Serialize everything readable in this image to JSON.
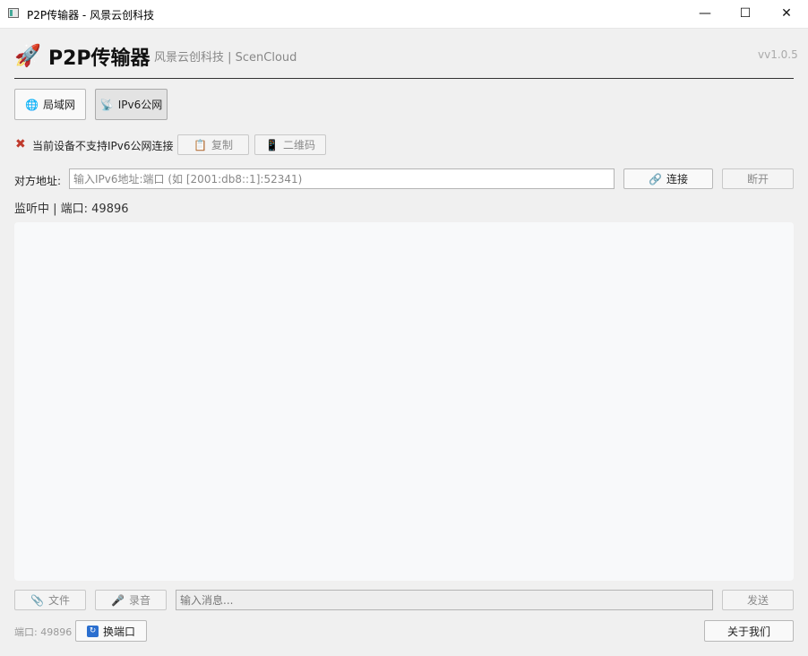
{
  "window": {
    "title": "P2P传输器 - 风景云创科技",
    "minimize_glyph": "—",
    "maximize_glyph": "☐",
    "close_glyph": "✕"
  },
  "header": {
    "logo_icon": "rocket-icon",
    "logo_glyph": "🚀",
    "title": "P2P传输器",
    "subtitle": "风景云创科技 | ScenCloud",
    "version": "vv1.0.5"
  },
  "mode_tabs": [
    {
      "label": "局域网",
      "icon": "globe-icon",
      "glyph": "🌐",
      "active": false
    },
    {
      "label": "IPv6公网",
      "icon": "satellite-icon",
      "glyph": "📡",
      "active": true
    }
  ],
  "ipv6_status": {
    "icon": "cross-icon",
    "glyph": "✖",
    "text": "当前设备不支持IPv6公网连接",
    "copy_label": "复制",
    "copy_glyph": "📋",
    "qr_label": "二维码",
    "qr_glyph": "📱"
  },
  "peer": {
    "label": "对方地址:",
    "placeholder": "输入IPv6地址:端口 (如 [2001:db8::1]:52341)",
    "value": "",
    "connect_label": "连接",
    "connect_glyph": "🔗",
    "disconnect_label": "断开"
  },
  "listen_status": "监听中 | 端口: 49896",
  "composer": {
    "file_label": "文件",
    "file_glyph": "📎",
    "record_label": "录音",
    "record_glyph": "🎤",
    "placeholder": "输入消息...",
    "send_label": "发送"
  },
  "footer": {
    "port_text": "端口: 49896",
    "change_port_label": "换端口",
    "change_port_glyph": "🔄",
    "about_label": "关于我们"
  },
  "colors": {
    "accent_blue": "#2b6fcf",
    "error_red": "#c0392b",
    "chat_bg": "#f8f9fa"
  }
}
